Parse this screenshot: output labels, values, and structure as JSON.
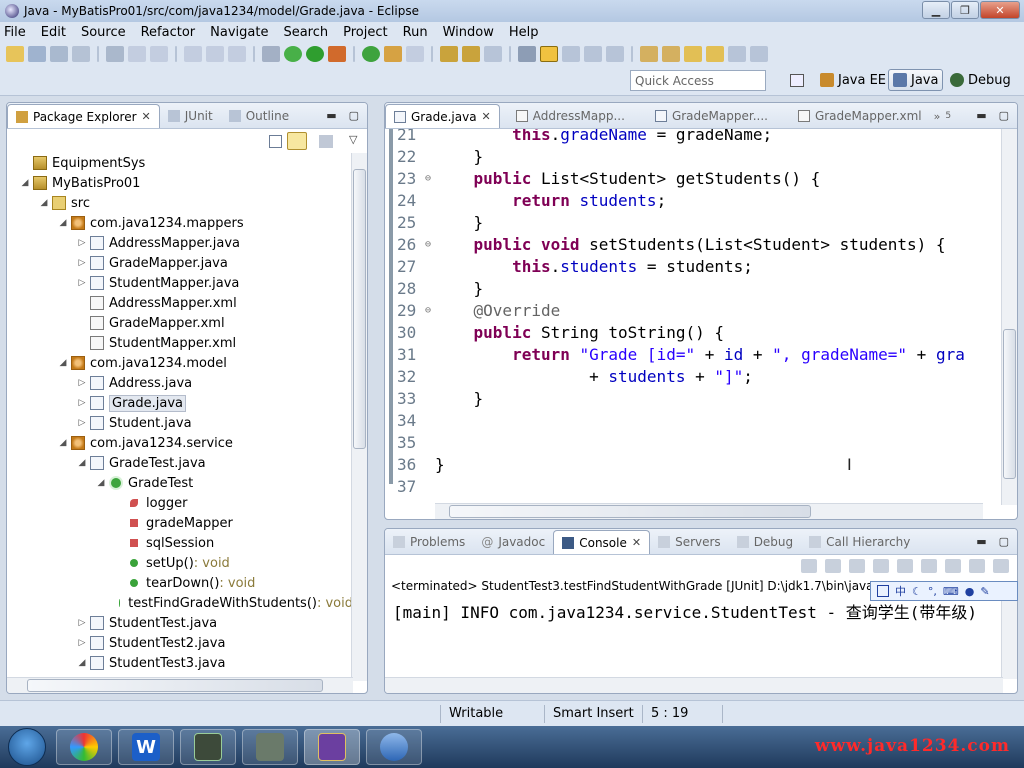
{
  "window": {
    "title": "Java - MyBatisPro01/src/com/java1234/model/Grade.java - Eclipse"
  },
  "menu": [
    "File",
    "Edit",
    "Source",
    "Refactor",
    "Navigate",
    "Search",
    "Project",
    "Run",
    "Window",
    "Help"
  ],
  "quick_access": {
    "placeholder": "Quick Access"
  },
  "perspectives": [
    {
      "label": "Java EE"
    },
    {
      "label": "Java",
      "active": true
    },
    {
      "label": "Debug"
    }
  ],
  "package_explorer": {
    "tabs": [
      "Package Explorer",
      "JUnit",
      "Outline"
    ],
    "tree": [
      {
        "label": "EquipmentSys",
        "icon": "project-icon",
        "level": 0,
        "arrow": ""
      },
      {
        "label": "MyBatisPro01",
        "icon": "project-icon",
        "level": 0,
        "arrow": "◢"
      },
      {
        "label": "src",
        "icon": "src-folder-icon",
        "level": 1,
        "arrow": "◢"
      },
      {
        "label": "com.java1234.mappers",
        "icon": "package-icon",
        "level": 2,
        "arrow": "◢"
      },
      {
        "label": "AddressMapper.java",
        "icon": "java-file-icon",
        "level": 3,
        "arrow": "▷"
      },
      {
        "label": "GradeMapper.java",
        "icon": "java-file-icon",
        "level": 3,
        "arrow": "▷"
      },
      {
        "label": "StudentMapper.java",
        "icon": "java-file-icon",
        "level": 3,
        "arrow": "▷"
      },
      {
        "label": "AddressMapper.xml",
        "icon": "xml-file-icon",
        "level": 3,
        "arrow": ""
      },
      {
        "label": "GradeMapper.xml",
        "icon": "xml-file-icon",
        "level": 3,
        "arrow": ""
      },
      {
        "label": "StudentMapper.xml",
        "icon": "xml-file-icon",
        "level": 3,
        "arrow": ""
      },
      {
        "label": "com.java1234.model",
        "icon": "package-icon",
        "level": 2,
        "arrow": "◢"
      },
      {
        "label": "Address.java",
        "icon": "java-file-icon",
        "level": 3,
        "arrow": "▷"
      },
      {
        "label": "Grade.java",
        "icon": "java-file-icon",
        "level": 3,
        "arrow": "▷",
        "selected": true
      },
      {
        "label": "Student.java",
        "icon": "java-file-icon",
        "level": 3,
        "arrow": "▷"
      },
      {
        "label": "com.java1234.service",
        "icon": "package-icon",
        "level": 2,
        "arrow": "◢"
      },
      {
        "label": "GradeTest.java",
        "icon": "java-file-icon",
        "level": 3,
        "arrow": "◢"
      },
      {
        "label": "GradeTest",
        "icon": "class-icon",
        "level": 4,
        "arrow": "◢"
      },
      {
        "label": "logger",
        "icon": "static-field-icon",
        "level": 5,
        "arrow": ""
      },
      {
        "label": "gradeMapper",
        "icon": "private-field-icon",
        "level": 5,
        "arrow": ""
      },
      {
        "label": "sqlSession",
        "icon": "private-field-icon",
        "level": 5,
        "arrow": ""
      },
      {
        "label": "setUp()",
        "suffix": " : void",
        "icon": "public-method-icon",
        "level": 5,
        "arrow": ""
      },
      {
        "label": "tearDown()",
        "suffix": " : void",
        "icon": "public-method-icon",
        "level": 5,
        "arrow": ""
      },
      {
        "label": "testFindGradeWithStudents()",
        "suffix": " : void",
        "icon": "public-method-icon",
        "level": 5,
        "arrow": ""
      },
      {
        "label": "StudentTest.java",
        "icon": "java-file-icon",
        "level": 3,
        "arrow": "▷"
      },
      {
        "label": "StudentTest2.java",
        "icon": "java-file-icon",
        "level": 3,
        "arrow": "▷"
      },
      {
        "label": "StudentTest3.java",
        "icon": "java-file-icon",
        "level": 3,
        "arrow": "◢"
      }
    ]
  },
  "editor": {
    "tabs": [
      {
        "label": "Grade.java",
        "active": true,
        "icon": "java-file-icon"
      },
      {
        "label": "AddressMapp...",
        "icon": "xml-file-icon"
      },
      {
        "label": "GradeMapper....",
        "icon": "java-file-icon"
      },
      {
        "label": "GradeMapper.xml",
        "icon": "xml-file-icon"
      }
    ],
    "overflow_count": "5",
    "lines": [
      {
        "n": "21",
        "fold": "",
        "html": "        <span class=\"kw\">this</span>.<span class=\"fld\">gradeName</span> = gradeName;"
      },
      {
        "n": "22",
        "fold": "",
        "html": "    }"
      },
      {
        "n": "23",
        "fold": "⊖",
        "html": "    <span class=\"kw\">public</span> List&lt;Student&gt; getStudents() {"
      },
      {
        "n": "24",
        "fold": "",
        "html": "        <span class=\"kw\">return</span> <span class=\"fld\">students</span>;"
      },
      {
        "n": "25",
        "fold": "",
        "html": "    }"
      },
      {
        "n": "26",
        "fold": "⊖",
        "html": "    <span class=\"kw\">public</span> <span class=\"kw\">void</span> setStudents(List&lt;Student&gt; students) {"
      },
      {
        "n": "27",
        "fold": "",
        "html": "        <span class=\"kw\">this</span>.<span class=\"fld\">students</span> = students;"
      },
      {
        "n": "28",
        "fold": "",
        "html": "    }"
      },
      {
        "n": "29",
        "fold": "⊖",
        "html": "    <span class=\"ann\">@Override</span>"
      },
      {
        "n": "30",
        "fold": "",
        "html": "    <span class=\"kw\">public</span> String toString() {"
      },
      {
        "n": "31",
        "fold": "",
        "html": "        <span class=\"kw\">return</span> <span class=\"str\">\"Grade [id=\"</span> + <span class=\"fld\">id</span> + <span class=\"str\">\", gradeName=\"</span> + <span class=\"fld\">gra</span>"
      },
      {
        "n": "32",
        "fold": "",
        "html": "                + <span class=\"fld\">students</span> + <span class=\"str\">\"]\"</span>;"
      },
      {
        "n": "33",
        "fold": "",
        "html": "    }"
      },
      {
        "n": "34",
        "fold": "",
        "html": ""
      },
      {
        "n": "35",
        "fold": "",
        "html": ""
      },
      {
        "n": "36",
        "fold": "",
        "html": "}"
      },
      {
        "n": "37",
        "fold": "",
        "html": ""
      }
    ]
  },
  "console": {
    "tabs": [
      "Problems",
      "Javadoc",
      "Console",
      "Servers",
      "Debug",
      "Call Hierarchy"
    ],
    "active_tab": "Console",
    "terminated": "<terminated> StudentTest3.testFindStudentWithGrade [JUnit] D:\\jdk1.7\\bin\\javaw.e",
    "output": "[main] INFO com.java1234.service.StudentTest - 查询学生(带年级)",
    "ime_label": "中"
  },
  "status": {
    "writable": "Writable",
    "insert_mode": "Smart Insert",
    "position": "5 : 19"
  },
  "taskbar": {
    "apps": [
      {
        "name": "pinwheel-app-icon",
        "glyph": ""
      },
      {
        "name": "wps-writer-app-icon",
        "glyph": "W"
      },
      {
        "name": "terminal-app-icon",
        "glyph": ""
      },
      {
        "name": "tool-app-icon",
        "glyph": ""
      },
      {
        "name": "eclipse-javaee-app-icon",
        "glyph": ""
      },
      {
        "name": "dolphin-app-icon",
        "glyph": ""
      }
    ],
    "watermark": "www.java1234.com"
  },
  "colors": {
    "keyword": "#7f0055",
    "field": "#0000c0",
    "string": "#2a00ff",
    "annotation": "#646464",
    "watermark": "#ff2a2a"
  }
}
